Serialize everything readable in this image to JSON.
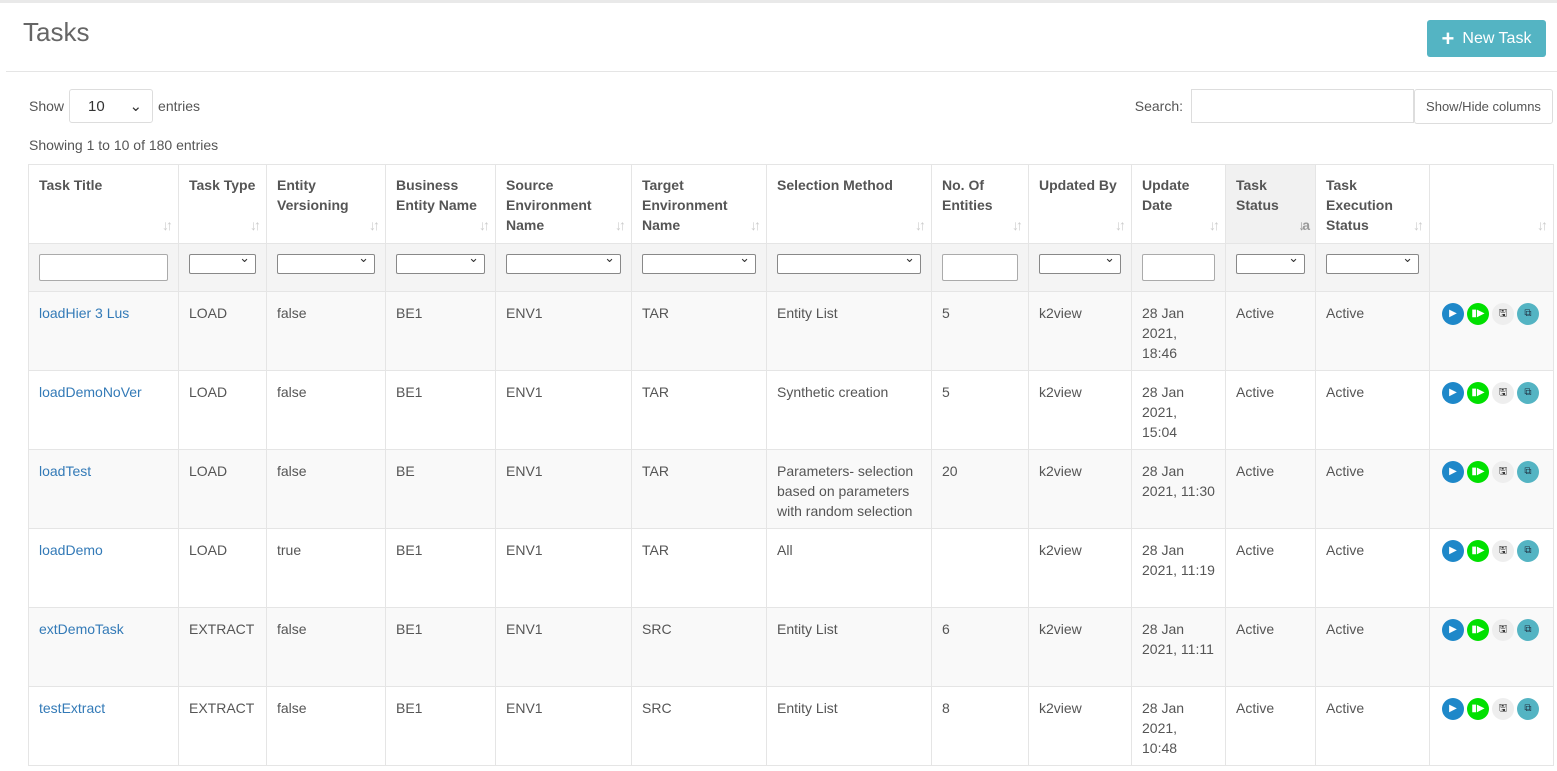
{
  "header": {
    "title": "Tasks",
    "new_task_label": "New Task"
  },
  "controls": {
    "show_label": "Show",
    "entries_value": "10",
    "entries_label": "entries",
    "search_label": "Search:",
    "search_value": "",
    "show_hide_label": "Show/Hide columns",
    "info": "Showing 1 to 10 of 180 entries"
  },
  "columns": [
    "Task Title",
    "Task Type",
    "Entity Versioning",
    "Business Entity Name",
    "Source Environment Name",
    "Target Environment Name",
    "Selection Method",
    "No. Of Entities",
    "Updated By",
    "Update Date",
    "Task Status",
    "Task Execution Status",
    ""
  ],
  "colors": {
    "accent": "#54b4c3",
    "link": "#337ab7",
    "run": "#1e88c9",
    "resume": "#00e000"
  },
  "rows": [
    {
      "title": "loadHier 3 Lus",
      "type": "LOAD",
      "versioning": "false",
      "be": "BE1",
      "source": "ENV1",
      "target": "TAR",
      "selection": "Entity List",
      "entities": "5",
      "updated_by": "k2view",
      "date": "28 Jan 2021, 18:46",
      "status": "Active",
      "exec_status": "Active"
    },
    {
      "title": "loadDemoNoVer",
      "type": "LOAD",
      "versioning": "false",
      "be": "BE1",
      "source": "ENV1",
      "target": "TAR",
      "selection": "Synthetic creation",
      "entities": "5",
      "updated_by": "k2view",
      "date": "28 Jan 2021, 15:04",
      "status": "Active",
      "exec_status": "Active"
    },
    {
      "title": "loadTest",
      "type": "LOAD",
      "versioning": "false",
      "be": "BE",
      "source": "ENV1",
      "target": "TAR",
      "selection": "Parameters- selection based on parameters with random selection",
      "entities": "20",
      "updated_by": "k2view",
      "date": "28 Jan 2021, 11:30",
      "status": "Active",
      "exec_status": "Active"
    },
    {
      "title": "loadDemo",
      "type": "LOAD",
      "versioning": "true",
      "be": "BE1",
      "source": "ENV1",
      "target": "TAR",
      "selection": "All",
      "entities": "",
      "updated_by": "k2view",
      "date": "28 Jan 2021, 11:19",
      "status": "Active",
      "exec_status": "Active"
    },
    {
      "title": "extDemoTask",
      "type": "EXTRACT",
      "versioning": "false",
      "be": "BE1",
      "source": "ENV1",
      "target": "SRC",
      "selection": "Entity List",
      "entities": "6",
      "updated_by": "k2view",
      "date": "28 Jan 2021, 11:11",
      "status": "Active",
      "exec_status": "Active"
    },
    {
      "title": "testExtract",
      "type": "EXTRACT",
      "versioning": "false",
      "be": "BE1",
      "source": "ENV1",
      "target": "SRC",
      "selection": "Entity List",
      "entities": "8",
      "updated_by": "k2view",
      "date": "28 Jan 2021, 10:48",
      "status": "Active",
      "exec_status": "Active"
    }
  ]
}
